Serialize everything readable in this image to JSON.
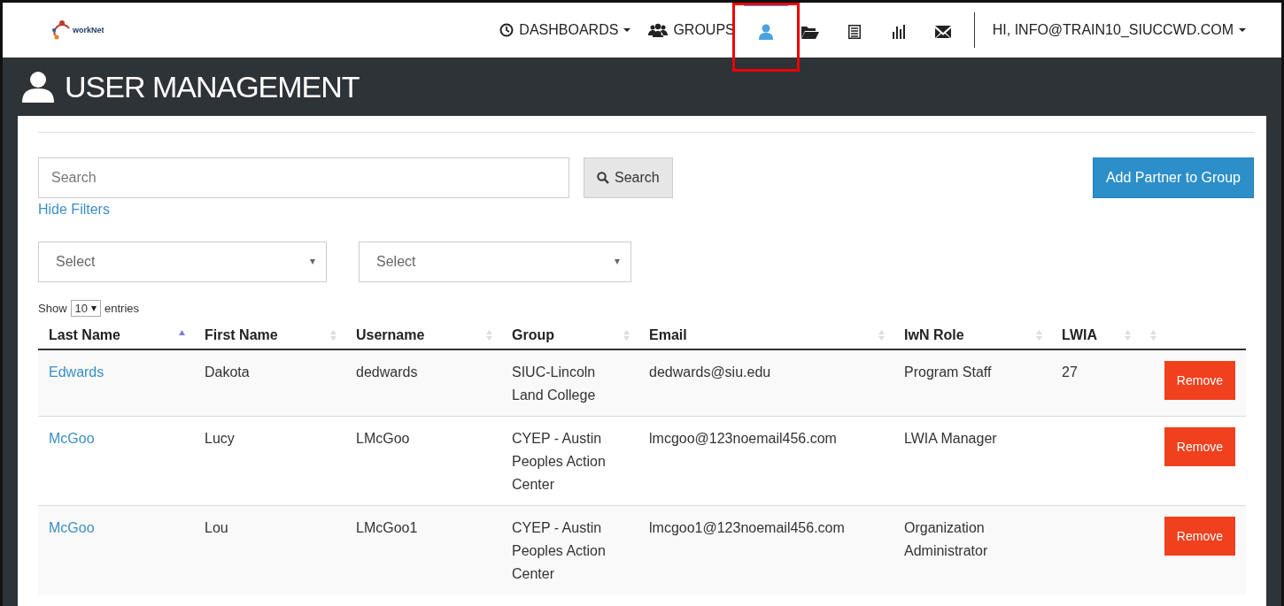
{
  "logo": {
    "text": "workNet"
  },
  "nav": {
    "items": [
      {
        "kind": "menu",
        "label": "DASHBOARDS",
        "selected": false
      },
      {
        "kind": "link",
        "label": "GROUPS",
        "selected": false
      },
      {
        "kind": "icon",
        "selected": true
      },
      {
        "kind": "icon",
        "selected": false
      },
      {
        "kind": "icon",
        "selected": false
      },
      {
        "kind": "icon",
        "selected": false
      },
      {
        "kind": "icon",
        "selected": false
      }
    ],
    "account": "HI, INFO@TRAIN10_SIUCCWD.COM"
  },
  "page_title": "USER MANAGEMENT",
  "search": {
    "placeholder": "Search",
    "button": "Search"
  },
  "add_button": "Add Partner to Group",
  "hide_filters": "Hide Filters",
  "filters": [
    {
      "placeholder": "Select"
    },
    {
      "placeholder": "Select"
    }
  ],
  "page_length": {
    "before": "Show",
    "value": "10",
    "after": "entries"
  },
  "table": {
    "columns": [
      {
        "label": "Last Name",
        "sorted": true
      },
      {
        "label": "First Name",
        "sorted": false
      },
      {
        "label": "Username",
        "sorted": false
      },
      {
        "label": "Group",
        "sorted": false
      },
      {
        "label": "Email",
        "sorted": false
      },
      {
        "label": "IwN Role",
        "sorted": false
      },
      {
        "label": "LWIA",
        "sorted": false
      },
      {
        "sorted": false
      }
    ],
    "rows": [
      {
        "last_name": "Edwards",
        "first_name": "Dakota",
        "username": "dedwards",
        "group": "SIUC-Lincoln Land College",
        "email": "dedwards@siu.edu",
        "role": "Program Staff",
        "lwia": "27",
        "action": "Remove"
      },
      {
        "last_name": "McGoo",
        "first_name": "Lucy",
        "username": "LMcGoo",
        "group": "CYEP - Austin Peoples Action Center",
        "email": "lmcgoo@123noemail456.com",
        "role": "LWIA Manager",
        "action": "Remove"
      },
      {
        "last_name": "McGoo",
        "first_name": "Lou",
        "username": "LMcGoo1",
        "group": "CYEP - Austin Peoples Action Center",
        "email": "lmcgoo1@123noemail456.com",
        "role": "Organization Administrator",
        "action": "Remove"
      }
    ]
  }
}
